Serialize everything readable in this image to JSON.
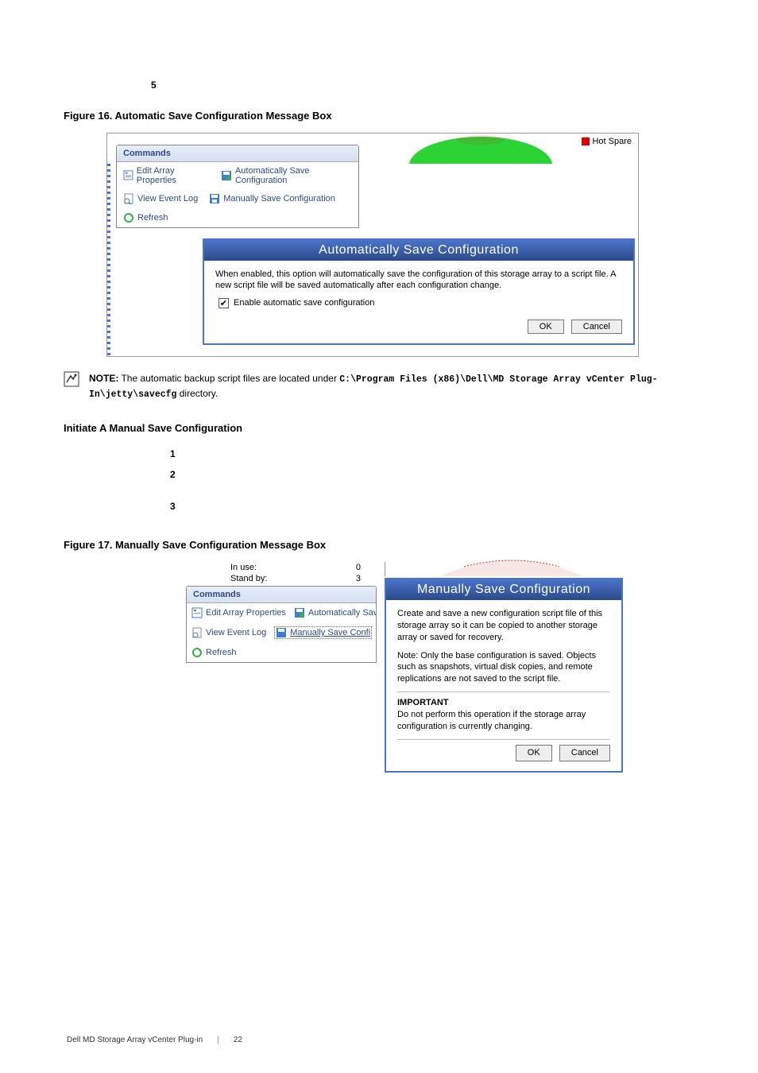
{
  "step5_num": "5",
  "figure16_caption": "Figure 16.  Automatic Save Configuration Message Box",
  "hot_spare": "Hot Spare",
  "commands_header": "Commands",
  "cmds": {
    "edit": "Edit Array Properties",
    "auto": "Automatically Save Configuration",
    "log": "View Event Log",
    "manual": "Manually Save Configuration",
    "refresh": "Refresh",
    "auto_trunc": "Automatically Save C",
    "manual_trunc": "Manually Save Confi"
  },
  "dlg16": {
    "title": "Automatically Save Configuration",
    "desc": "When enabled, this option will automatically save the configuration of this storage array to a script file. A new script file will be saved automatically after each configuration change.",
    "checkbox": "Enable automatic save configuration",
    "ok": "OK",
    "cancel": "Cancel"
  },
  "note": {
    "label": "NOTE:",
    "text_before": " The automatic backup script files are located under ",
    "path": "C:\\Program Files (x86)\\Dell\\MD Storage Array vCenter Plug-In\\jetty\\savecfg",
    "text_after": " directory."
  },
  "manual_section_title": "Initiate A Manual Save Configuration",
  "steps": {
    "n1": "1",
    "n2": "2",
    "n3": "3"
  },
  "figure17_caption": "Figure 17.  Manually Save Configuration Message Box",
  "stats": {
    "inuse_label": "In use:",
    "inuse_val": "0",
    "standby_label": "Stand by:",
    "standby_val": "3"
  },
  "dlg17": {
    "title": "Manually Save Configuration",
    "p1": "Create and save a new configuration script file of this storage array so it can be copied to another storage array or saved for recovery.",
    "p2": "Note: Only the base configuration is saved. Objects such as snapshots, virtual disk copies, and remote replications are not saved to the script file.",
    "imp_label": "IMPORTANT",
    "imp_text": "Do not perform this operation if the storage array configuration is currently changing.",
    "ok": "OK",
    "cancel": "Cancel"
  },
  "footer": {
    "product": "Dell MD Storage Array vCenter Plug-in",
    "page": "22"
  }
}
